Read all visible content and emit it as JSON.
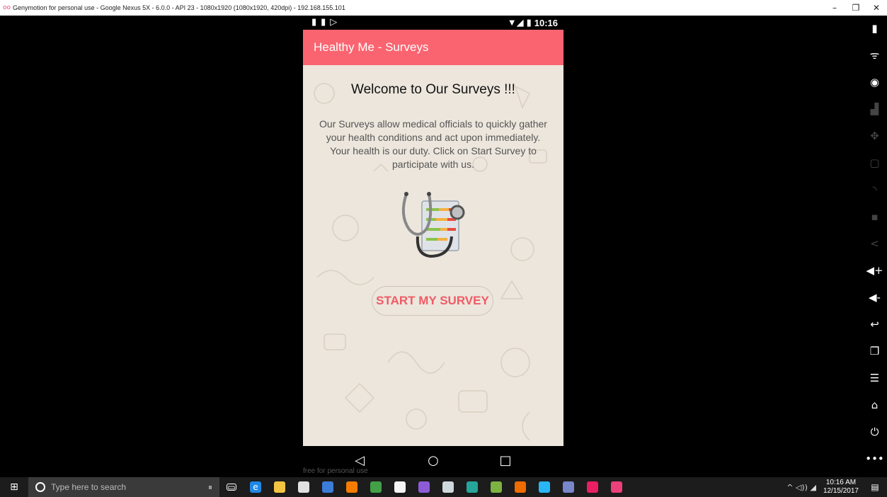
{
  "window": {
    "logo": "oo",
    "title": "Genymotion for personal use - Google Nexus 5X - 6.0.0 - API 23 - 1080x1920 (1080x1920, 420dpi) - 192.168.155.101",
    "minimize": "–",
    "restore": "❐",
    "close": "✕"
  },
  "statusbar": {
    "left_icons": "▮▮▷",
    "signal": "▼◢",
    "battery": "▮",
    "time": "10:16"
  },
  "appbar": {
    "title": "Healthy Me - Surveys"
  },
  "main": {
    "heading": "Welcome to Our Surveys !!!",
    "description": "Our Surveys allow medical officials to quickly gather your health conditions and act upon immediately. Your health is our duty. Click on Start Survey to participate with us.",
    "start_button": "START MY SURVEY"
  },
  "navbar": {
    "back": "◁",
    "home": "○",
    "recents": "□"
  },
  "watermark": "free for personal use",
  "toolbar": {
    "items": [
      {
        "icon": "battery-icon",
        "glyph": "▮",
        "dim": false
      },
      {
        "icon": "gps-icon",
        "glyph": "ᯤ",
        "dim": false
      },
      {
        "icon": "webcam-icon",
        "glyph": "◉",
        "dim": false
      },
      {
        "icon": "screencast-icon",
        "glyph": "▟",
        "dim": true
      },
      {
        "icon": "dpad-icon",
        "glyph": "✥",
        "dim": true
      },
      {
        "icon": "id-icon",
        "glyph": "▢",
        "dim": true
      },
      {
        "icon": "rss-icon",
        "glyph": "◝",
        "dim": true
      },
      {
        "icon": "sms-icon",
        "glyph": "▪",
        "dim": true
      },
      {
        "icon": "share-icon",
        "glyph": "<",
        "dim": true
      },
      {
        "icon": "volume-up-icon",
        "glyph": "◀+",
        "dim": false
      },
      {
        "icon": "volume-down-icon",
        "glyph": "◀-",
        "dim": false
      },
      {
        "icon": "back-icon",
        "glyph": "↩",
        "dim": false
      },
      {
        "icon": "recent-apps-icon",
        "glyph": "❐",
        "dim": false
      },
      {
        "icon": "menu-icon",
        "glyph": "☰",
        "dim": false
      },
      {
        "icon": "home-icon",
        "glyph": "⌂",
        "dim": false
      },
      {
        "icon": "power-icon",
        "glyph": "⏻",
        "dim": false
      },
      {
        "icon": "more-icon",
        "glyph": "•••",
        "dim": false
      }
    ]
  },
  "taskbar": {
    "start_glyph": "⊞",
    "search_placeholder": "Type here to search",
    "mic_glyph": "⏸",
    "apps": [
      {
        "name": "task-view-icon",
        "color": "#1c1c1c",
        "glyph": "▭"
      },
      {
        "name": "edge-icon",
        "color": "#1e88e5",
        "glyph": "e"
      },
      {
        "name": "file-explorer-icon",
        "color": "#f4c542",
        "glyph": ""
      },
      {
        "name": "mail-icon",
        "color": "#e0e0e0",
        "glyph": ""
      },
      {
        "name": "app-cube-icon",
        "color": "#3b7dd8",
        "glyph": ""
      },
      {
        "name": "firefox-icon",
        "color": "#f57c00",
        "glyph": ""
      },
      {
        "name": "android-studio-icon",
        "color": "#43a047",
        "glyph": ""
      },
      {
        "name": "store-icon",
        "color": "#f5f5f5",
        "glyph": ""
      },
      {
        "name": "visual-studio-icon",
        "color": "#8e5bd8",
        "glyph": ""
      },
      {
        "name": "app-disk-icon",
        "color": "#cfd8dc",
        "glyph": ""
      },
      {
        "name": "app-window-icon",
        "color": "#26a69a",
        "glyph": ""
      },
      {
        "name": "pycharm-icon",
        "color": "#7cb342",
        "glyph": ""
      },
      {
        "name": "app-orange-icon",
        "color": "#ef6c00",
        "glyph": ""
      },
      {
        "name": "skype-icon",
        "color": "#29b6f6",
        "glyph": ""
      },
      {
        "name": "network-icon",
        "color": "#7986cb",
        "glyph": ""
      },
      {
        "name": "genymotion-icon",
        "color": "#e91e63",
        "glyph": ""
      },
      {
        "name": "genymotion-active-icon",
        "color": "#ec407a",
        "glyph": ""
      }
    ],
    "tray_icons": "^ ◁)) ◢",
    "time": "10:16 AM",
    "date": "12/15/2017",
    "notifications": "▤"
  }
}
